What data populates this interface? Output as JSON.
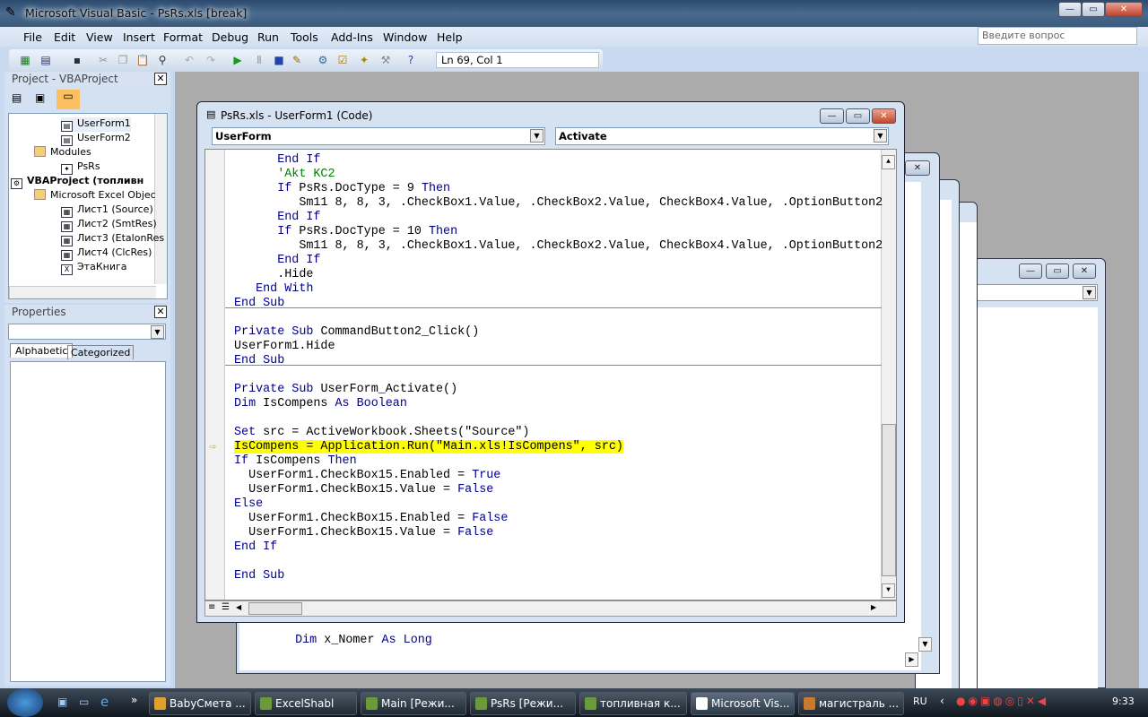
{
  "app": {
    "title": "Microsoft Visual Basic - PsRs.xls [break]"
  },
  "menu": [
    "File",
    "Edit",
    "View",
    "Insert",
    "Format",
    "Debug",
    "Run",
    "Tools",
    "Add-Ins",
    "Window",
    "Help"
  ],
  "help_placeholder": "Введите вопрос",
  "toolbar": {
    "position": "Ln 69, Col 1",
    "icons": [
      "excel-icon",
      "insert-userform-icon",
      "save-icon",
      "cut-icon",
      "copy-icon",
      "paste-icon",
      "find-icon",
      "undo-icon",
      "redo-icon",
      "run-icon",
      "break-icon",
      "reset-icon",
      "design-mode-icon",
      "project-explorer-icon",
      "properties-icon",
      "object-browser-icon",
      "toolbox-icon",
      "help-icon"
    ]
  },
  "project": {
    "title": "Project - VBAProject",
    "items": [
      {
        "label": "UserForm1",
        "icon": "form-icon"
      },
      {
        "label": "UserForm2",
        "icon": "form-icon"
      },
      {
        "label": "Modules",
        "icon": "folder-icon"
      },
      {
        "label": "PsRs",
        "icon": "module-icon"
      },
      {
        "label": "VBAProject (топливн",
        "icon": "project-icon"
      },
      {
        "label": "Microsoft Excel Objec",
        "icon": "folder-icon"
      },
      {
        "label": "Лист1 (Source)",
        "icon": "sheet-icon"
      },
      {
        "label": "Лист2 (SmtRes)",
        "icon": "sheet-icon"
      },
      {
        "label": "Лист3 (EtalonRes",
        "icon": "sheet-icon"
      },
      {
        "label": "Лист4 (ClcRes)",
        "icon": "sheet-icon"
      },
      {
        "label": "ЭтаКнига",
        "icon": "workbook-icon"
      }
    ]
  },
  "properties": {
    "title": "Properties",
    "tabs": [
      "Alphabetic",
      "Categorized"
    ]
  },
  "code_window": {
    "title": "PsRs.xls - UserForm1 (Code)",
    "object": "UserForm",
    "procedure": "Activate",
    "lines": [
      [
        [
          "      ",
          ""
        ],
        [
          "End If",
          "kw"
        ]
      ],
      [
        [
          "      ",
          ""
        ],
        [
          "'Akt KC2",
          "cm"
        ]
      ],
      [
        [
          "      ",
          ""
        ],
        [
          "If",
          "kw"
        ],
        [
          " PsRs.DocType = 9 ",
          ""
        ],
        [
          "Then",
          "kw"
        ]
      ],
      [
        [
          "         Sm11 8, 8, 3, .CheckBox1.Value, .CheckBox2.Value, CheckBox4.Value, .OptionButton2",
          ""
        ]
      ],
      [
        [
          "      ",
          ""
        ],
        [
          "End If",
          "kw"
        ]
      ],
      [
        [
          "      ",
          ""
        ],
        [
          "If",
          "kw"
        ],
        [
          " PsRs.DocType = 10 ",
          ""
        ],
        [
          "Then",
          "kw"
        ]
      ],
      [
        [
          "         Sm11 8, 8, 3, .CheckBox1.Value, .CheckBox2.Value, CheckBox4.Value, .OptionButton2",
          ""
        ]
      ],
      [
        [
          "      ",
          ""
        ],
        [
          "End If",
          "kw"
        ]
      ],
      [
        [
          "      .Hide",
          ""
        ]
      ],
      [
        [
          "   ",
          ""
        ],
        [
          "End With",
          "kw"
        ]
      ],
      [
        [
          "End Sub",
          "kw"
        ]
      ],
      [],
      [
        [
          "Private Sub",
          "kw"
        ],
        [
          " CommandButton2_Click()",
          ""
        ]
      ],
      [
        [
          "UserForm1.Hide",
          ""
        ]
      ],
      [
        [
          "End Sub",
          "kw"
        ]
      ],
      [],
      [
        [
          "Private Sub",
          "kw"
        ],
        [
          " UserForm_Activate()",
          ""
        ]
      ],
      [
        [
          "Dim",
          "kw"
        ],
        [
          " IsCompens ",
          ""
        ],
        [
          "As Boolean",
          "kw"
        ]
      ],
      [],
      [
        [
          "Set",
          "kw"
        ],
        [
          " src = ActiveWorkbook.Sheets(\"Source\")",
          ""
        ]
      ],
      [
        [
          "IsCompens = Application.Run(\"Main.xls!IsCompens\", src)",
          "hl"
        ]
      ],
      [
        [
          "If",
          "kw"
        ],
        [
          " IsCompens ",
          ""
        ],
        [
          "Then",
          "kw"
        ]
      ],
      [
        [
          "  UserForm1.CheckBox15.Enabled = ",
          ""
        ],
        [
          "True",
          "kw"
        ]
      ],
      [
        [
          "  UserForm1.CheckBox15.Value = ",
          ""
        ],
        [
          "False",
          "kw"
        ]
      ],
      [
        [
          "Else",
          "kw"
        ]
      ],
      [
        [
          "  UserForm1.CheckBox15.Enabled = ",
          ""
        ],
        [
          "False",
          "kw"
        ]
      ],
      [
        [
          "  UserForm1.CheckBox15.Value = ",
          ""
        ],
        [
          "False",
          "kw"
        ]
      ],
      [
        [
          "End If",
          "kw"
        ]
      ],
      [],
      [
        [
          "End Sub",
          "kw"
        ]
      ]
    ],
    "execution_line": 20,
    "separators_after": [
      10,
      14
    ]
  },
  "background_window": {
    "line": [
      [
        "   ",
        ""
      ],
      [
        "Dim",
        "kw"
      ],
      [
        " x_Nomer ",
        ""
      ],
      [
        "As Long",
        "kw"
      ]
    ]
  },
  "taskbar": {
    "items": [
      "BabyСмета ...",
      "ExcelShabl",
      "Main  [Режи...",
      "PsRs  [Режи...",
      "топливная к...",
      "Microsoft Vis...",
      "магистраль ..."
    ],
    "active": 5,
    "language": "RU",
    "clock": "9:33"
  },
  "colors": {
    "keyword": "#00008b",
    "comment": "#008000",
    "highlight": "#ffff00"
  }
}
